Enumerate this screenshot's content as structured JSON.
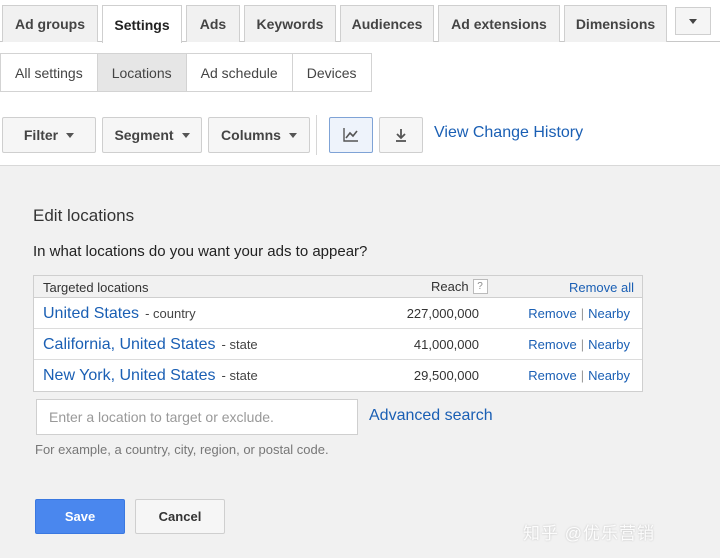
{
  "tabs": [
    {
      "label": "Ad groups",
      "active": false
    },
    {
      "label": "Settings",
      "active": true
    },
    {
      "label": "Ads",
      "active": false
    },
    {
      "label": "Keywords",
      "active": false
    },
    {
      "label": "Audiences",
      "active": false
    },
    {
      "label": "Ad extensions",
      "active": false
    },
    {
      "label": "Dimensions",
      "active": false
    }
  ],
  "tab_more_icon": "chevron-down-icon",
  "subtabs": [
    {
      "label": "All settings",
      "active": false
    },
    {
      "label": "Locations",
      "active": true
    },
    {
      "label": "Ad schedule",
      "active": false
    },
    {
      "label": "Devices",
      "active": false
    }
  ],
  "toolbar": {
    "filter_label": "Filter",
    "segment_label": "Segment",
    "columns_label": "Columns",
    "chart_icon": "line-chart-icon",
    "download_icon": "download-icon",
    "view_change_history": "View Change History"
  },
  "panel": {
    "title": "Edit locations",
    "question": "In what locations do you want your ads to appear?",
    "table": {
      "header_targeted": "Targeted locations",
      "header_reach": "Reach",
      "help_mark": "?",
      "remove_all": "Remove all",
      "rows": [
        {
          "name": "United States",
          "type": "- country",
          "reach": "227,000,000",
          "remove": "Remove",
          "nearby": "Nearby"
        },
        {
          "name": "California, United States",
          "type": "- state",
          "reach": "41,000,000",
          "remove": "Remove",
          "nearby": "Nearby"
        },
        {
          "name": "New York, United States",
          "type": "- state",
          "reach": "29,500,000",
          "remove": "Remove",
          "nearby": "Nearby"
        }
      ]
    },
    "input_placeholder": "Enter a location to target or exclude.",
    "advanced_search": "Advanced search",
    "hint": "For example, a country, city, region, or postal code.",
    "save_label": "Save",
    "cancel_label": "Cancel"
  },
  "watermark": "知乎 @优乐营销",
  "colors": {
    "link": "#1a5fb4",
    "save_button": "#4a87ee",
    "panel_bg": "#f1f1f1"
  }
}
